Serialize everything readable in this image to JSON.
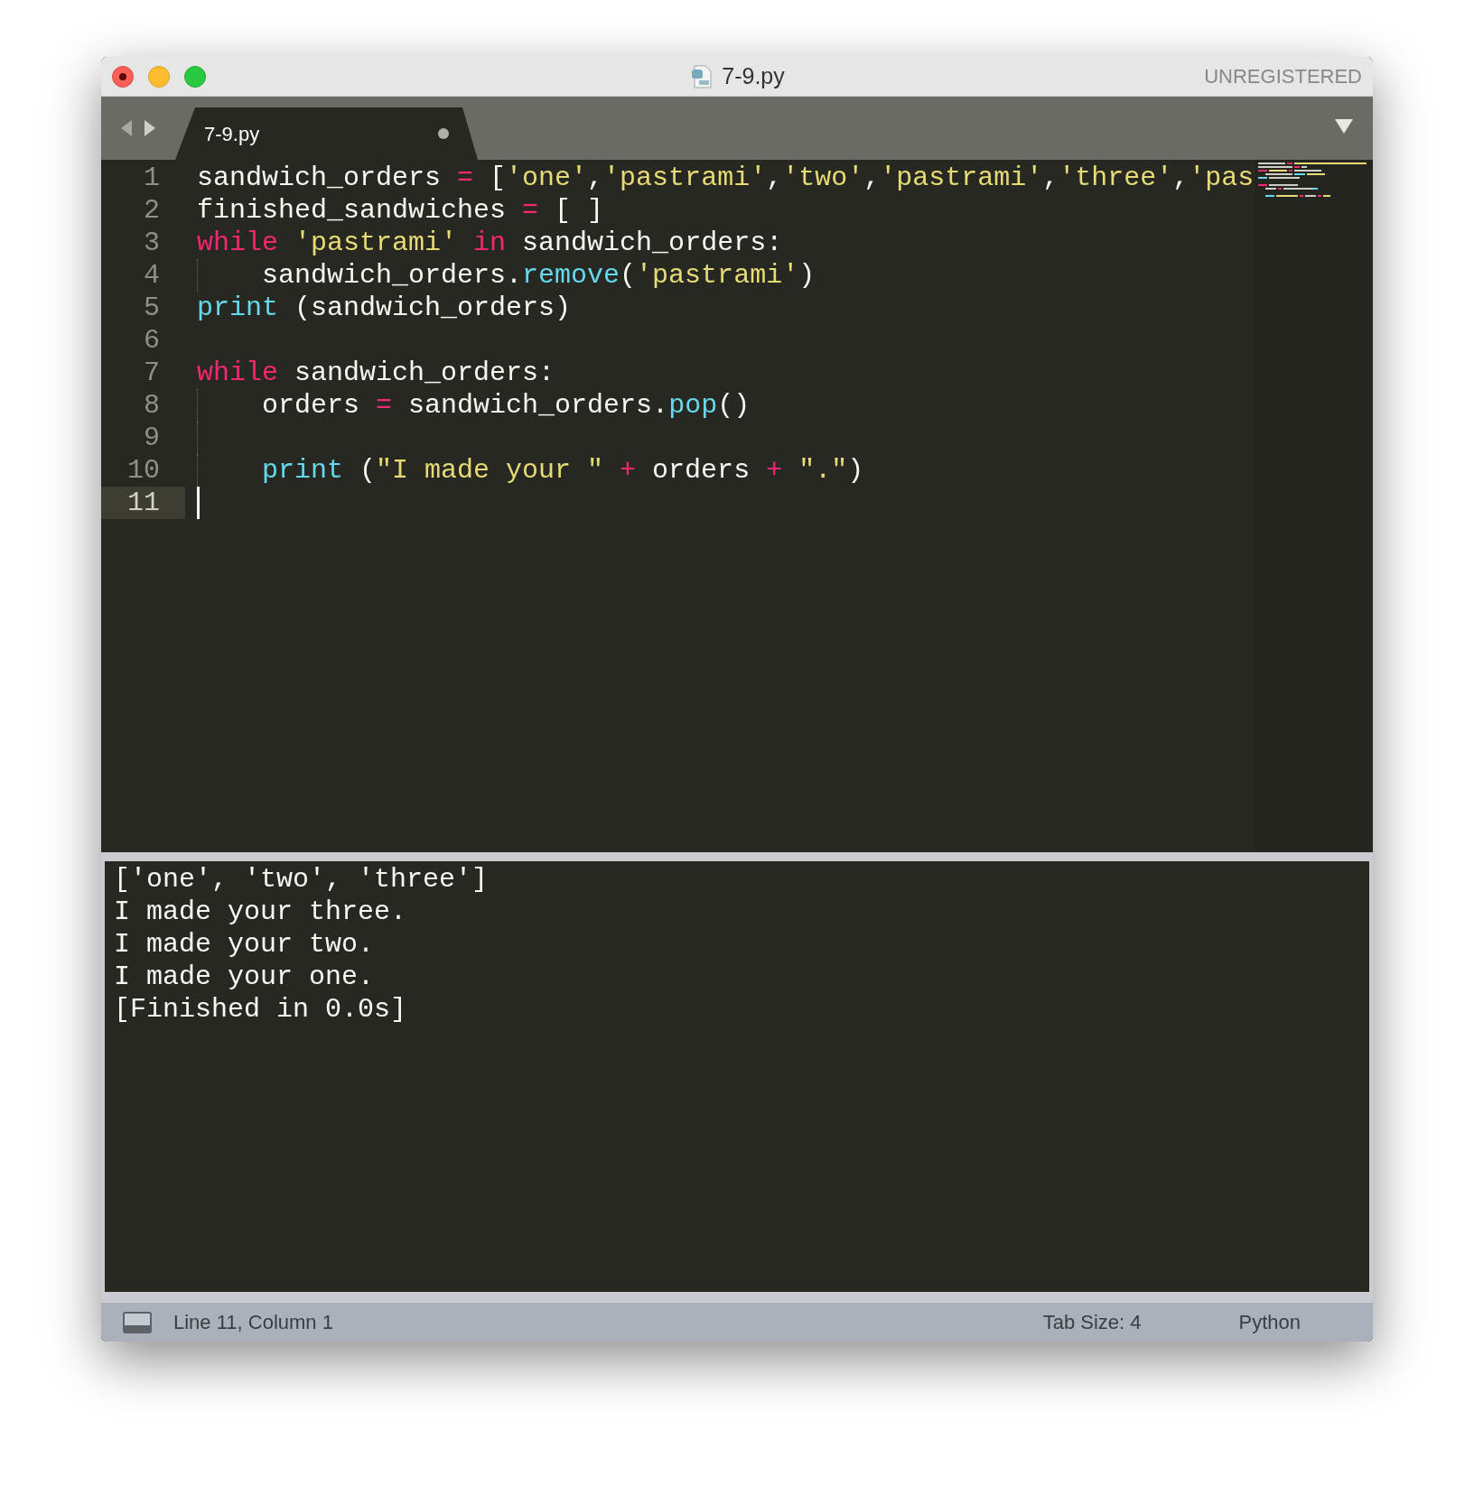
{
  "window": {
    "title": "7-9.py",
    "registration": "UNREGISTERED"
  },
  "tabs": [
    {
      "label": "7-9.py",
      "selected": true,
      "modified": true
    }
  ],
  "editor": {
    "lines": [
      {
        "number": "1",
        "current": false,
        "tokens": [
          {
            "kind": "plain",
            "text": "sandwich_orders "
          },
          {
            "kind": "operator",
            "text": "="
          },
          {
            "kind": "plain",
            "text": " ["
          },
          {
            "kind": "string",
            "text": "'one'"
          },
          {
            "kind": "plain",
            "text": ","
          },
          {
            "kind": "string",
            "text": "'pastrami'"
          },
          {
            "kind": "plain",
            "text": ","
          },
          {
            "kind": "string",
            "text": "'two'"
          },
          {
            "kind": "plain",
            "text": ","
          },
          {
            "kind": "string",
            "text": "'pastrami'"
          },
          {
            "kind": "plain",
            "text": ","
          },
          {
            "kind": "string",
            "text": "'three'"
          },
          {
            "kind": "plain",
            "text": ","
          },
          {
            "kind": "string",
            "text": "'pas"
          }
        ]
      },
      {
        "number": "2",
        "current": false,
        "tokens": [
          {
            "kind": "plain",
            "text": "finished_sandwiches "
          },
          {
            "kind": "operator",
            "text": "="
          },
          {
            "kind": "plain",
            "text": " [ ]"
          }
        ]
      },
      {
        "number": "3",
        "current": false,
        "tokens": [
          {
            "kind": "keyword",
            "text": "while "
          },
          {
            "kind": "string",
            "text": "'pastrami' "
          },
          {
            "kind": "keyword",
            "text": "in"
          },
          {
            "kind": "plain",
            "text": " sandwich_orders:"
          }
        ]
      },
      {
        "number": "4",
        "current": false,
        "tokens": [
          {
            "kind": "plain",
            "text": "    sandwich_orders."
          },
          {
            "kind": "function",
            "text": "remove"
          },
          {
            "kind": "plain",
            "text": "("
          },
          {
            "kind": "string",
            "text": "'pastrami'"
          },
          {
            "kind": "plain",
            "text": ")"
          }
        ]
      },
      {
        "number": "5",
        "current": false,
        "tokens": [
          {
            "kind": "function",
            "text": "print"
          },
          {
            "kind": "plain",
            "text": " (sandwich_orders)"
          }
        ]
      },
      {
        "number": "6",
        "current": false
      },
      {
        "number": "7",
        "current": false,
        "tokens": [
          {
            "kind": "keyword",
            "text": "while"
          },
          {
            "kind": "plain",
            "text": " sandwich_orders:"
          }
        ]
      },
      {
        "number": "8",
        "current": false,
        "tokens": [
          {
            "kind": "plain",
            "text": "    orders "
          },
          {
            "kind": "operator",
            "text": "="
          },
          {
            "kind": "plain",
            "text": " sandwich_orders."
          },
          {
            "kind": "function",
            "text": "pop"
          },
          {
            "kind": "plain",
            "text": "()"
          }
        ]
      },
      {
        "number": "9",
        "current": false
      },
      {
        "number": "10",
        "current": false,
        "tokens": [
          {
            "kind": "function",
            "text": "    print"
          },
          {
            "kind": "plain",
            "text": " ("
          },
          {
            "kind": "string",
            "text": "\"I made your \" "
          },
          {
            "kind": "operator",
            "text": "+"
          },
          {
            "kind": "plain",
            "text": " orders "
          },
          {
            "kind": "operator",
            "text": "+ "
          },
          {
            "kind": "string",
            "text": "\".\""
          },
          {
            "kind": "plain",
            "text": ")"
          }
        ]
      },
      {
        "number": "11",
        "current": true
      }
    ]
  },
  "output": {
    "lines": [
      "['one', 'two', 'three']",
      "I made your three.",
      "I made your two.",
      "I made your one.",
      "[Finished in 0.0s]"
    ]
  },
  "status_bar": {
    "position": "Line 11, Column 1",
    "tab_size": "Tab Size: 4",
    "syntax": "Python"
  }
}
